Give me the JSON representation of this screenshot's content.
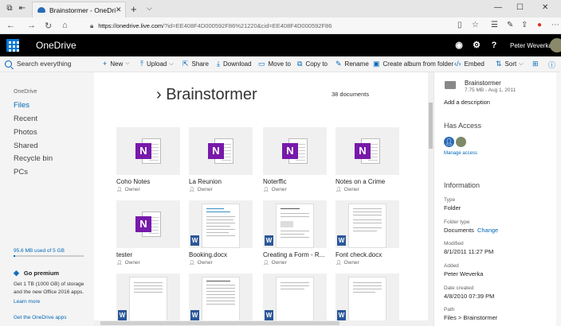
{
  "browser": {
    "tab_title": "Brainstormer - OneDriv",
    "url_host": "https://onedrive.live.com",
    "url_rest": "/?id=EE408F4D000592F86%21220&cid=EE408F4D000592F86"
  },
  "header": {
    "app_name": "OneDrive",
    "user_name": "Peter Weverka"
  },
  "commands": {
    "search": "Search everything",
    "new": "New",
    "upload": "Upload",
    "share": "Share",
    "download": "Download",
    "move_to": "Move to",
    "copy_to": "Copy to",
    "rename": "Rename",
    "create_album": "Create album from folder",
    "embed": "Embed",
    "sort": "Sort"
  },
  "sidebar": {
    "heading": "OneDrive",
    "items": [
      {
        "label": "Files"
      },
      {
        "label": "Recent"
      },
      {
        "label": "Photos"
      },
      {
        "label": "Shared"
      },
      {
        "label": "Recycle bin"
      },
      {
        "label": "PCs"
      }
    ],
    "storage": "95.6 MB used of 5 GB",
    "storage_used_fraction": 0.019,
    "premium": "Go premium",
    "promo": "Get 1 TB (1000 GB) of storage and the new Office 2016 apps.",
    "learn_more": "Learn more",
    "get_apps": "Get the OneDrive apps"
  },
  "main": {
    "breadcrumb": "Brainstormer",
    "count": "38 documents",
    "files": [
      {
        "name": "Coho Notes",
        "owner": "Owner",
        "type": "onenote"
      },
      {
        "name": "La Reunion",
        "owner": "Owner",
        "type": "onenote"
      },
      {
        "name": "Noterffic",
        "owner": "Owner",
        "type": "onenote"
      },
      {
        "name": "Notes on a Crime",
        "owner": "Owner",
        "type": "onenote"
      },
      {
        "name": "tester",
        "owner": "Owner",
        "type": "onenote"
      },
      {
        "name": "Booking.docx",
        "owner": "Owner",
        "type": "word"
      },
      {
        "name": "Creating a Form - R...",
        "owner": "Owner",
        "type": "word"
      },
      {
        "name": "Font check.docx",
        "owner": "Owner",
        "type": "word"
      }
    ]
  },
  "details": {
    "name": "Brainstormer",
    "meta": "7.75 MB - Aug 1, 2011",
    "add_description": "Add a description",
    "has_access": "Has Access",
    "manage_access": "Manage access",
    "information": "Information",
    "type_label": "Type",
    "type_value": "Folder",
    "folder_type_label": "Folder type",
    "folder_type_value": "Documents",
    "change": "Change",
    "modified_label": "Modified",
    "modified_value": "8/1/2011 11:27 PM",
    "added_label": "Added",
    "added_value": "Peter Weverka",
    "created_label": "Date created",
    "created_value": "4/8/2010 07:39 PM",
    "path_label": "Path",
    "path_value": "Files > Brainstormer"
  },
  "colors": {
    "accent": "#0067b8",
    "onenote": "#7719aa",
    "word": "#2b579a",
    "header_bg": "#000000"
  }
}
